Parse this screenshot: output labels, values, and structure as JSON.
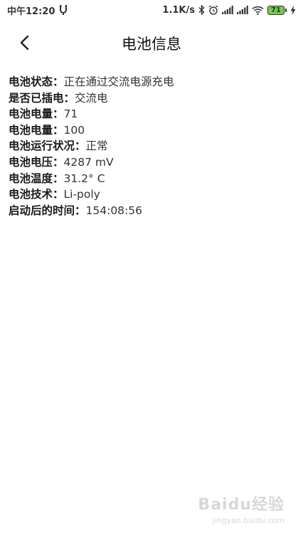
{
  "status_bar": {
    "time": "中午12:20",
    "network_speed": "1.1K/s",
    "battery_level": "71",
    "icons": [
      "usb-debug-icon",
      "bluetooth-icon",
      "alarm-icon",
      "signal-icon",
      "signal-icon",
      "wifi-icon",
      "battery-icon",
      "charging-icon"
    ]
  },
  "header": {
    "title": "电池信息",
    "back_icon": "chevron-left-icon"
  },
  "battery_info": [
    {
      "label": "电池状态：",
      "value": "正在通过交流电源充电"
    },
    {
      "label": "是否已插电：",
      "value": "交流电"
    },
    {
      "label": "电池电量：",
      "value": "71"
    },
    {
      "label": "电池电量：",
      "value": "100"
    },
    {
      "label": "电池运行状况：",
      "value": "正常"
    },
    {
      "label": "电池电压：",
      "value": "4287 mV"
    },
    {
      "label": "电池温度：",
      "value": "31.2° C"
    },
    {
      "label": "电池技术：",
      "value": "Li-poly"
    },
    {
      "label": "启动后的时间：",
      "value": "154:08:56"
    }
  ],
  "watermark": {
    "brand": "Baidu经验",
    "url": "jingyan.baidu.com"
  },
  "colors": {
    "battery_fill": "#7bc94a",
    "text": "#222222",
    "background": "#ffffff"
  }
}
